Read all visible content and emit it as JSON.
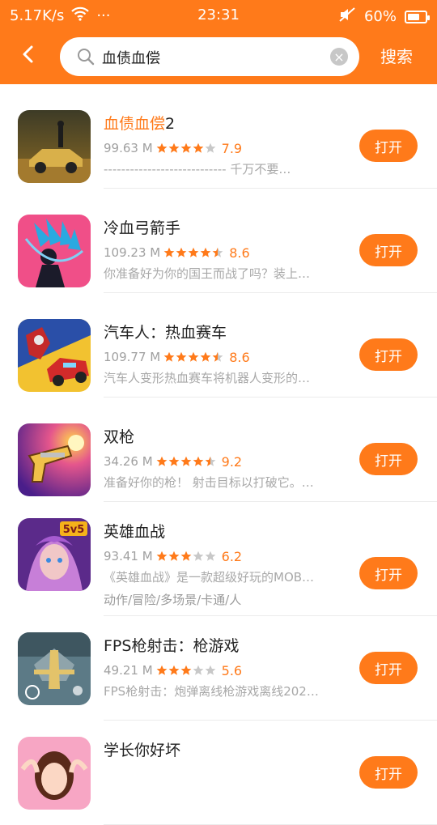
{
  "status_bar": {
    "speed": "5.17K/s",
    "dots": "···",
    "time": "23:31",
    "battery_text": "60%"
  },
  "search": {
    "value": "血债血偿",
    "clear_symbol": "×",
    "submit_label": "搜索"
  },
  "results": [
    {
      "title_highlight": "血债血偿",
      "title_rest": "2",
      "size": "99.63 M",
      "stars": 4,
      "rating": "7.9",
      "desc": "---------------------------- 千万不要…",
      "open_label": "打开",
      "icon": "car-shooter-icon"
    },
    {
      "title_highlight": "",
      "title_rest": "冷血弓箭手",
      "size": "109.23 M",
      "stars": 4.5,
      "rating": "8.6",
      "desc": "你准备好为你的国王而战了吗？装上…",
      "open_label": "打开",
      "icon": "archer-icon"
    },
    {
      "title_highlight": "",
      "title_rest": "汽车人：热血赛车",
      "size": "109.77 M",
      "stars": 4.5,
      "rating": "8.6",
      "desc": "汽车人变形热血赛车将机器人变形的…",
      "open_label": "打开",
      "icon": "robot-car-icon"
    },
    {
      "title_highlight": "",
      "title_rest": "双枪",
      "size": "34.26 M",
      "stars": 4.5,
      "rating": "9.2",
      "desc": "准备好你的枪！  射击目标以打破它。…",
      "open_label": "打开",
      "icon": "gun-icon"
    },
    {
      "title_highlight": "",
      "title_rest": "英雄血战",
      "size": "93.41 M",
      "stars": 3,
      "rating": "6.2",
      "desc": "《英雄血战》是一款超级好玩的MOB…",
      "tags": "动作/冒险/多场景/卡通/人",
      "open_label": "打开",
      "icon": "hero-5v5-icon"
    },
    {
      "title_highlight": "",
      "title_rest": "FPS枪射击：枪游戏",
      "size": "49.21 M",
      "stars": 3,
      "rating": "5.6",
      "desc": "FPS枪射击：炮弹离线枪游戏离线202…",
      "open_label": "打开",
      "icon": "fps-map-icon"
    },
    {
      "title_highlight": "",
      "title_rest": "学长你好坏",
      "size": "",
      "stars": 0,
      "rating": "",
      "desc": "",
      "open_label": "打开",
      "icon": "anime-girl-icon"
    }
  ],
  "colors": {
    "accent": "#FF7A1A",
    "star_gray": "#c8c8c8"
  }
}
